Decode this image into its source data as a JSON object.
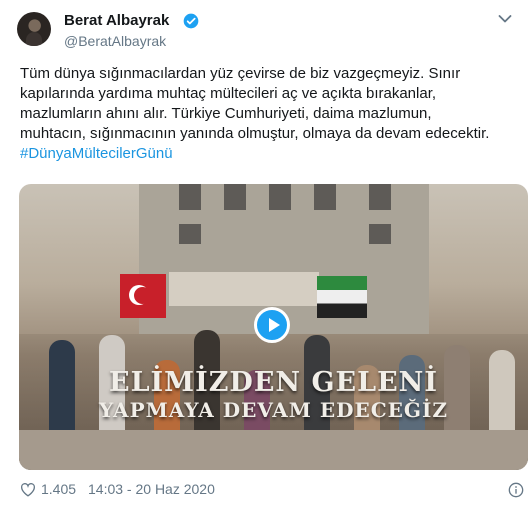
{
  "author": {
    "name": "Berat Albayrak",
    "handle": "@BeratAlbayrak",
    "avatar_icon": "profile-photo",
    "verified_icon": "verified-badge-icon"
  },
  "menu_icon": "chevron-down-icon",
  "tweet": {
    "lines": [
      "Tüm dünya sığınmacılardan yüz çevirse de biz vazgeçmeyiz. Sınır",
      "kapılarında yardıma muhtaç mültecileri aç ve açıkta bırakanlar,",
      "mazlumların ahını alır. Türkiye Cumhuriyeti, daima mazlumun,",
      "muhtacın, sığınmacının yanında olmuştur, olmaya da devam edecektir."
    ],
    "hashtag": "#DünyaMültecilerGünü"
  },
  "media": {
    "caption_line1": "ELİMİZDEN GELENİ",
    "caption_line2": "YAPMAYA DEVAM EDECEĞİZ",
    "play_icon": "play-button-icon",
    "colors": {
      "play": "#1da1f2"
    }
  },
  "footer": {
    "likes": "1.405",
    "timestamp": "14:03 - 20 Haz 2020",
    "heart_icon": "heart-icon",
    "info_icon": "info-icon"
  },
  "colors": {
    "hashtag": "#1b95e0",
    "secondary_text": "#657786",
    "verified": "#1da1f2"
  }
}
